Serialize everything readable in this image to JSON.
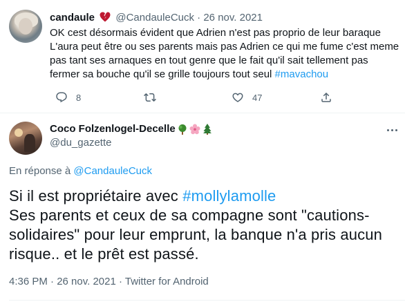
{
  "tweet1": {
    "author_name": "candaule",
    "author_emoji": "broken-heart-icon",
    "handle": "@CandauleCuck",
    "separator": "·",
    "date": "26 nov. 2021",
    "text_lines": [
      "OK cest désormais évident que Adrien n'est pas proprio de leur baraque",
      "L'aura peut être ou ses parents mais pas Adrien ce qui me fume c'est meme",
      "pas tant ses arnaques en tout genre que le fait qu'il sait tellement pas",
      "fermer sa bouche qu'il se grille toujours tout seul "
    ],
    "hashtag": "#mavachou",
    "actions": {
      "reply_count": "8",
      "retweet_count": "",
      "like_count": "47"
    }
  },
  "tweet2": {
    "author_name": "Coco Folzenlogel-Decelle",
    "author_emojis": [
      "deciduous-tree-icon",
      "cherry-blossom-icon",
      "evergreen-tree-icon"
    ],
    "handle": "@du_gazette",
    "reply_prefix": "En réponse à ",
    "reply_to": "@CandauleCuck",
    "line1_text": "Si il est propriétaire avec ",
    "line1_hashtag": "#mollylamolle",
    "text_lines": [
      "Ses parents et ceux de sa compagne sont \"cautions-",
      "solidaires\" pour leur emprunt, la banque n'a pris aucun",
      "risque.. et le prêt est passé."
    ],
    "meta": "4:36 PM · 26 nov. 2021 · Twitter for Android"
  },
  "colors": {
    "link": "#1d9bf0",
    "secondary_text": "#536471",
    "primary_text": "#0f1419",
    "divider": "#eff3f4"
  }
}
